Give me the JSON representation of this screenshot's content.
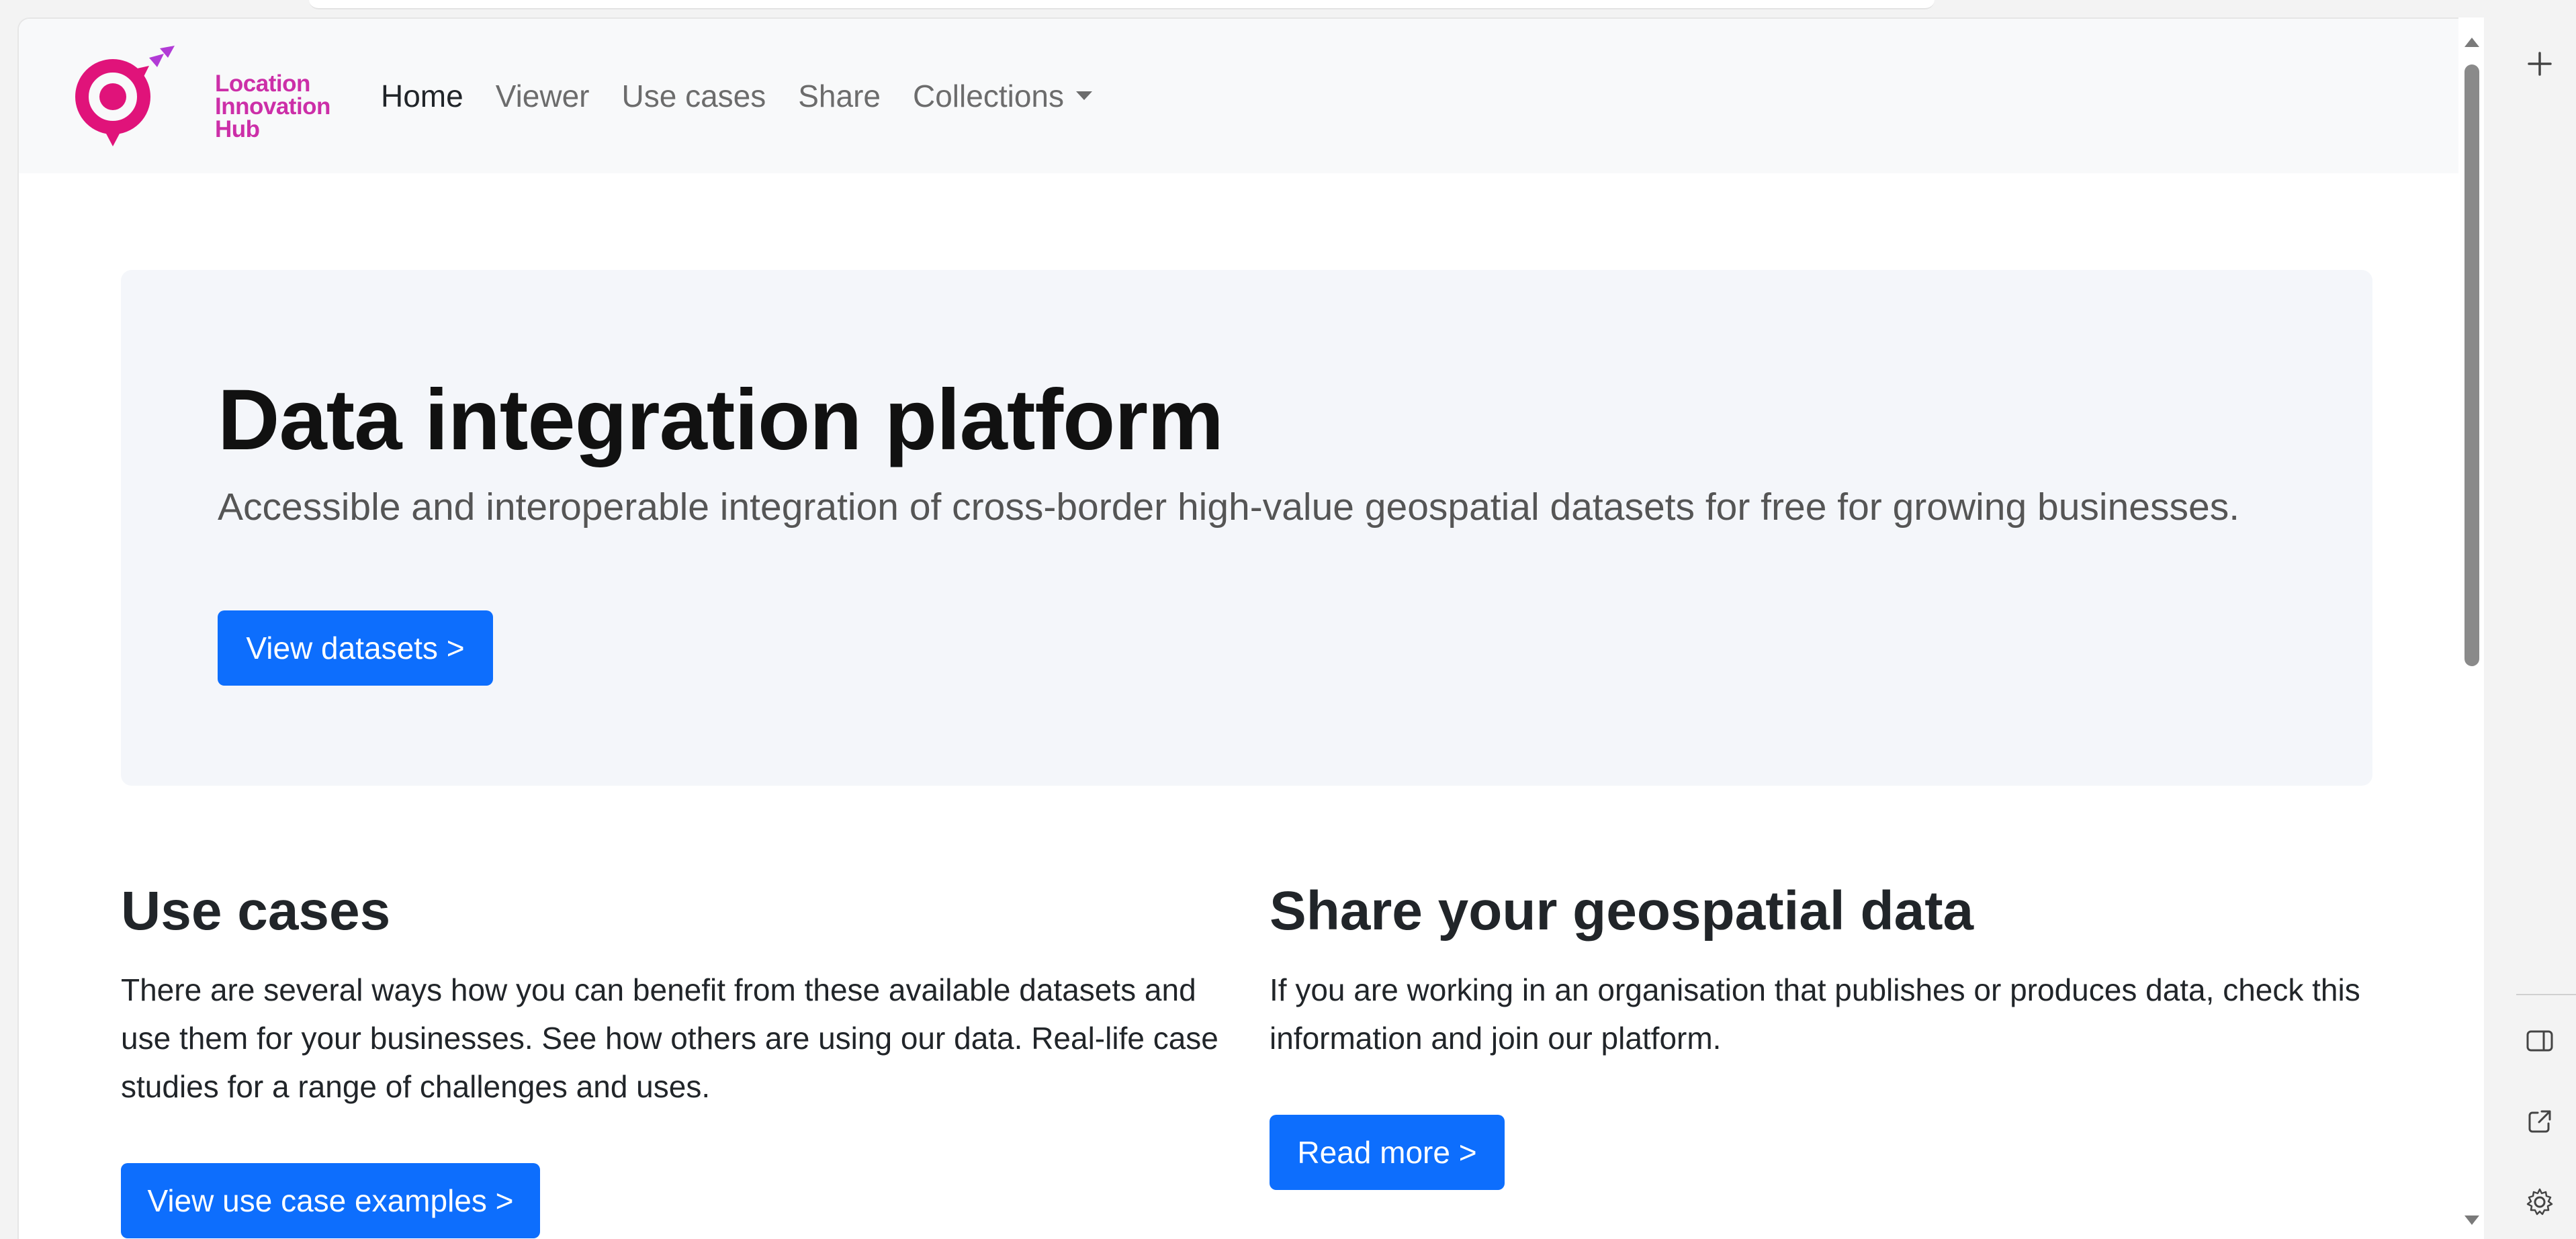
{
  "brand": {
    "logo_lines": [
      "Location",
      "Innovation",
      "Hub"
    ],
    "colors": {
      "magenta": "#e0137a",
      "purple": "#b23bd6",
      "text": "#cc2fa8"
    }
  },
  "nav": {
    "items": [
      {
        "label": "Home",
        "active": true
      },
      {
        "label": "Viewer"
      },
      {
        "label": "Use cases"
      },
      {
        "label": "Share"
      },
      {
        "label": "Collections",
        "dropdown": true
      }
    ]
  },
  "hero": {
    "title": "Data integration platform",
    "lead": "Accessible and interoperable integration of cross-border high-value geospatial datasets for free for growing businesses.",
    "button": "View datasets >"
  },
  "use_cases": {
    "title": "Use cases",
    "text": "There are several ways how you can benefit from these available datasets and use them for your businesses. See how others are using our data. Real-life case studies for a range of challenges and uses.",
    "button": "View use case examples >"
  },
  "share": {
    "title": "Share your geospatial data",
    "text": "If you are working in an organisation that publishes or produces data, check this information and join our platform.",
    "button": "Read more >"
  },
  "colors": {
    "primary": "#0d6efd",
    "navbar_bg": "#f8f9fa",
    "hero_bg": "#f4f6fa"
  },
  "side_panel": {
    "icons": [
      "plus-icon",
      "sidebar-toggle-icon",
      "open-external-icon",
      "settings-gear-icon"
    ]
  }
}
